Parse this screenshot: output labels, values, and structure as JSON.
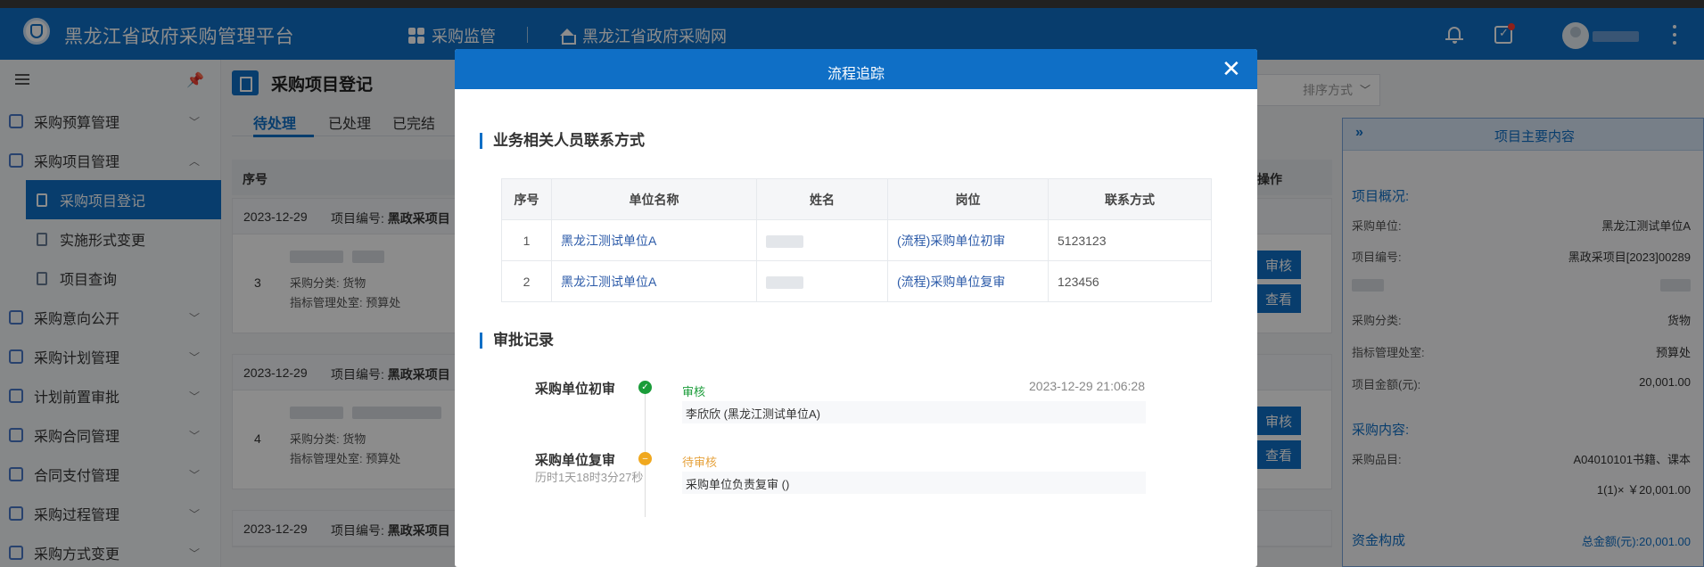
{
  "app": {
    "title": "黑龙江省政府采购管理平台"
  },
  "topnav": {
    "item1": "采购监管",
    "item2": "黑龙江省政府采购网"
  },
  "sidebar": {
    "items": [
      {
        "label": "采购预算管理"
      },
      {
        "label": "采购项目管理"
      },
      {
        "label": "采购意向公开"
      },
      {
        "label": "采购计划管理"
      },
      {
        "label": "计划前置审批"
      },
      {
        "label": "采购合同管理"
      },
      {
        "label": "合同支付管理"
      },
      {
        "label": "采购过程管理"
      },
      {
        "label": "采购方式变更"
      }
    ],
    "sub_items": [
      {
        "label": "采购项目登记"
      },
      {
        "label": "实施形式变更"
      },
      {
        "label": "项目查询"
      }
    ]
  },
  "page": {
    "title": "采购项目登记",
    "tabs": [
      "待处理",
      "已处理",
      "已完结"
    ],
    "sort_placeholder": "排序方式",
    "table_headers": {
      "seq": "序号",
      "op": "操作"
    },
    "groups": [
      {
        "date": "2023-12-29",
        "code_label": "项目编号:",
        "code_value": "黑政采项目",
        "num": "3",
        "category_label": "采购分类:",
        "category": "货物",
        "dept_label": "指标管理处室:",
        "dept": "预算处",
        "btn1": "审核",
        "btn2": "查看"
      },
      {
        "date": "2023-12-29",
        "code_label": "项目编号:",
        "code_value": "黑政采项目",
        "num": "4",
        "category_label": "采购分类:",
        "category": "货物",
        "dept_label": "指标管理处室:",
        "dept": "预算处",
        "btn1": "审核",
        "btn2": "查看"
      },
      {
        "date": "2023-12-29",
        "code_label": "项目编号:",
        "code_value": "黑政采项目"
      }
    ]
  },
  "right_panel": {
    "title": "项目主要内容",
    "overview": "项目概况:",
    "unit_label": "采购单位:",
    "unit": "黑龙江测试单位A",
    "code_label": "项目编号:",
    "code": "黑政采项目[2023]00289",
    "cat_label": "采购分类:",
    "cat": "货物",
    "dept_label": "指标管理处室:",
    "dept": "预算处",
    "amount_label": "项目金额(元):",
    "amount": "20,001.00",
    "content": "采购内容:",
    "item_label": "采购品目:",
    "item": "A04010101书籍、课本",
    "qty": "1(1)× ￥20,001.00",
    "funds": "资金构成",
    "total_label": "总金额(元):",
    "total": "20,001.00"
  },
  "modal": {
    "title": "流程追踪",
    "contacts_title": "业务相关人员联系方式",
    "contacts_headers": [
      "序号",
      "单位名称",
      "姓名",
      "岗位",
      "联系方式"
    ],
    "contacts": [
      {
        "seq": "1",
        "unit": "黑龙江测试单位A",
        "post": "(流程)采购单位初审",
        "phone": "5123123"
      },
      {
        "seq": "2",
        "unit": "黑龙江测试单位A",
        "post": "(流程)采购单位复审",
        "phone": "123456"
      }
    ],
    "approval_title": "审批记录",
    "records": [
      {
        "node": "采购单位初审",
        "status": "审核",
        "time": "2023-12-29 21:06:28",
        "detail": "李欣欣 (黑龙江测试单位A)"
      },
      {
        "node": "采购单位复审",
        "duration": "历时1天18时3分27秒",
        "status": "待审核",
        "detail": "采购单位负责复审 ()"
      }
    ]
  },
  "colors": {
    "primary": "#0f6fc6",
    "success": "#1a9c39",
    "warning": "#f0a81f"
  }
}
